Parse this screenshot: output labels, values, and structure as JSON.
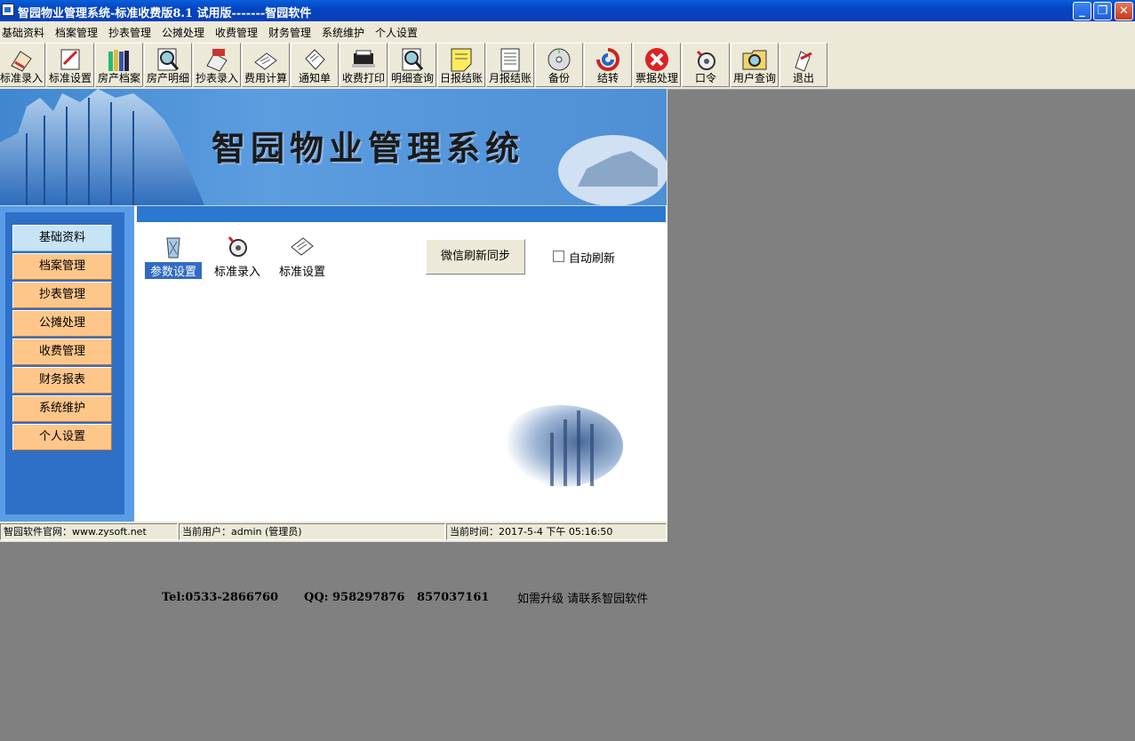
{
  "window": {
    "title": "智园物业管理系统-标准收费版8.1 试用版-------智园软件",
    "minimize": "_",
    "restore": "❐",
    "close": "✕"
  },
  "menu": [
    "基础资料",
    "档案管理",
    "抄表管理",
    "公摊处理",
    "收费管理",
    "财务管理",
    "系统维护",
    "个人设置"
  ],
  "toolbar": [
    {
      "label": "标准录入",
      "icon": "pen-paper-icon"
    },
    {
      "label": "标准设置",
      "icon": "notebook-pen-icon"
    },
    {
      "label": "房产档案",
      "icon": "books-icon"
    },
    {
      "label": "房产明细",
      "icon": "magnifier-icon"
    },
    {
      "label": "抄表录入",
      "icon": "meter-entry-icon"
    },
    {
      "label": "费用计算",
      "icon": "calculation-icon"
    },
    {
      "label": "通知单",
      "icon": "notice-icon"
    },
    {
      "label": "收费打印",
      "icon": "printer-icon"
    },
    {
      "label": "明细查询",
      "icon": "search-doc-icon"
    },
    {
      "label": "日报结账",
      "icon": "note-icon"
    },
    {
      "label": "月报结账",
      "icon": "report-icon"
    },
    {
      "label": "备份",
      "icon": "backup-disc-icon"
    },
    {
      "label": "结转",
      "icon": "transfer-icon"
    },
    {
      "label": "票据处理",
      "icon": "cancel-icon"
    },
    {
      "label": "口令",
      "icon": "password-icon"
    },
    {
      "label": "用户查询",
      "icon": "user-search-icon"
    },
    {
      "label": "退出",
      "icon": "exit-icon"
    }
  ],
  "banner": {
    "title": "智园物业管理系统"
  },
  "sidebar": [
    "基础资料",
    "档案管理",
    "抄表管理",
    "公摊处理",
    "收费管理",
    "财务报表",
    "系统维护",
    "个人设置"
  ],
  "content": {
    "icons": [
      {
        "label": "参数设置",
        "icon": "parameter-icon",
        "selected": true
      },
      {
        "label": "标准录入",
        "icon": "standard-entry-icon",
        "selected": false
      },
      {
        "label": "标准设置",
        "icon": "standard-setting-icon",
        "selected": false
      }
    ],
    "wechat_button": "微信刷新同步",
    "auto_refresh_label": "自动刷新",
    "tel": "Tel:0533-2866760",
    "qq": "QQ: 958297876",
    "qq2": "857037161",
    "upgrade": "如需升级 请联系智园软件"
  },
  "status": {
    "website": "智园软件官网：www.zysoft.net",
    "user": "当前用户：admin (管理员)",
    "time": "当前时间：2017-5-4 下午 05:16:50"
  },
  "colors": {
    "accent": "#2a78d0",
    "nav_button": "#ffc68a",
    "nav_active": "#c7e3f5",
    "desktop": "#808080"
  }
}
